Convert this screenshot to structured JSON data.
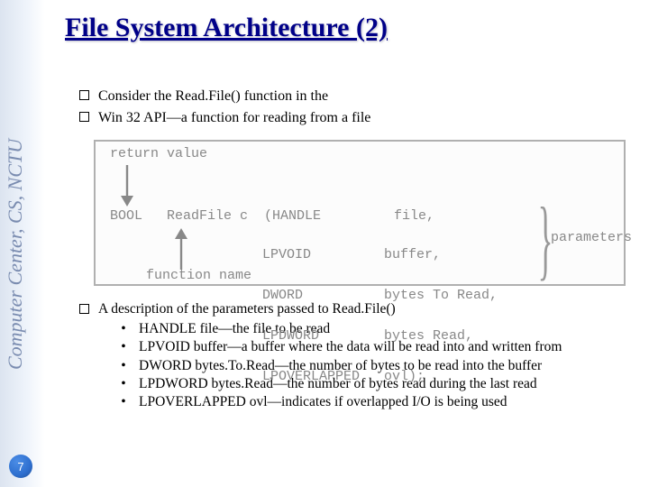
{
  "sidebar": {
    "org": "Computer Center, CS, NCTU",
    "page_number": "7"
  },
  "title": "File System Architecture (2)",
  "bullets": {
    "b1": "Consider the Read.File() function in the",
    "b2": "Win 32 API—a function for reading from a file"
  },
  "diagram": {
    "return_label": "return value",
    "code_prefix": "BOOL   ReadFile c  (HANDLE         file,",
    "p2": "LPVOID         buffer,",
    "p3": "DWORD          bytes To Read,",
    "p4": "LPDWORD        bytes Read,",
    "p5": "LPOVERLAPPED   ovl);",
    "fn_label": "function name",
    "params_label": "parameters"
  },
  "desc": {
    "head": "A description of the parameters passed to Read.File()",
    "s1": "HANDLE file—the file to be read",
    "s2": "LPVOID buffer—a buffer where the data will be read into and written from",
    "s3": "DWORD bytes.To.Read—the number of bytes to be read into the buffer",
    "s4": "LPDWORD bytes.Read—the number of bytes read during the last read",
    "s5": "LPOVERLAPPED ovl—indicates if overlapped I/O is being used"
  }
}
